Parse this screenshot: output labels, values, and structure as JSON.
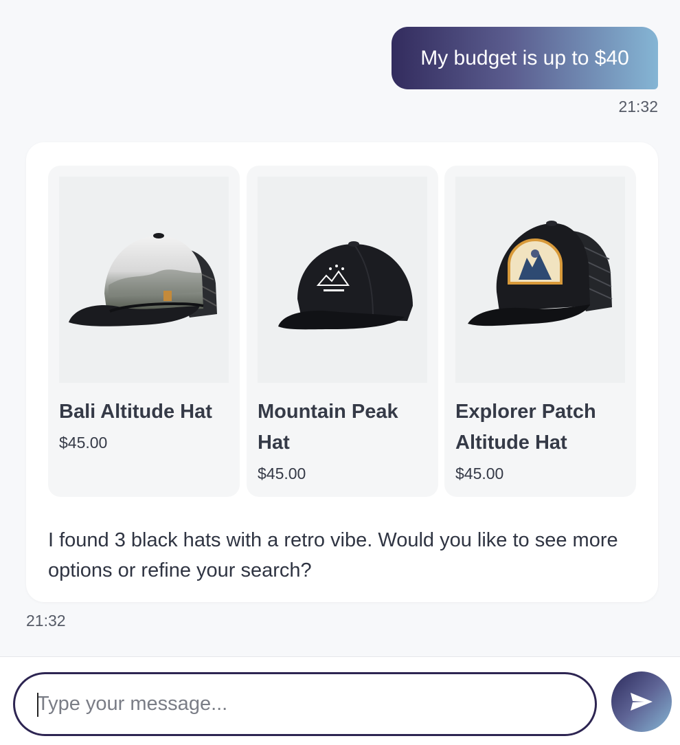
{
  "colors": {
    "accent_dark": "#2d2552",
    "accent_light": "#85b5d4",
    "text": "#2f3442",
    "background": "#f7f8fa"
  },
  "chat": {
    "user_message": {
      "text": "My budget is up to $40",
      "time": "21:32"
    },
    "bot_message": {
      "products": [
        {
          "name": "Bali Altitude Hat",
          "price": "$45.00",
          "image": "trucker-cap-landscape-print"
        },
        {
          "name": "Mountain Peak Hat",
          "price": "$45.00",
          "image": "black-baseball-cap-mountain-logo"
        },
        {
          "name": "Explorer Patch Altitude Hat",
          "price": "$45.00",
          "image": "black-trucker-cap-patch"
        }
      ],
      "text": "I found 3 black hats with a retro vibe. Would you like to see more options or refine your search?",
      "time": "21:32"
    }
  },
  "composer": {
    "placeholder": "Type your message...",
    "value": "",
    "send_icon": "send-icon"
  }
}
